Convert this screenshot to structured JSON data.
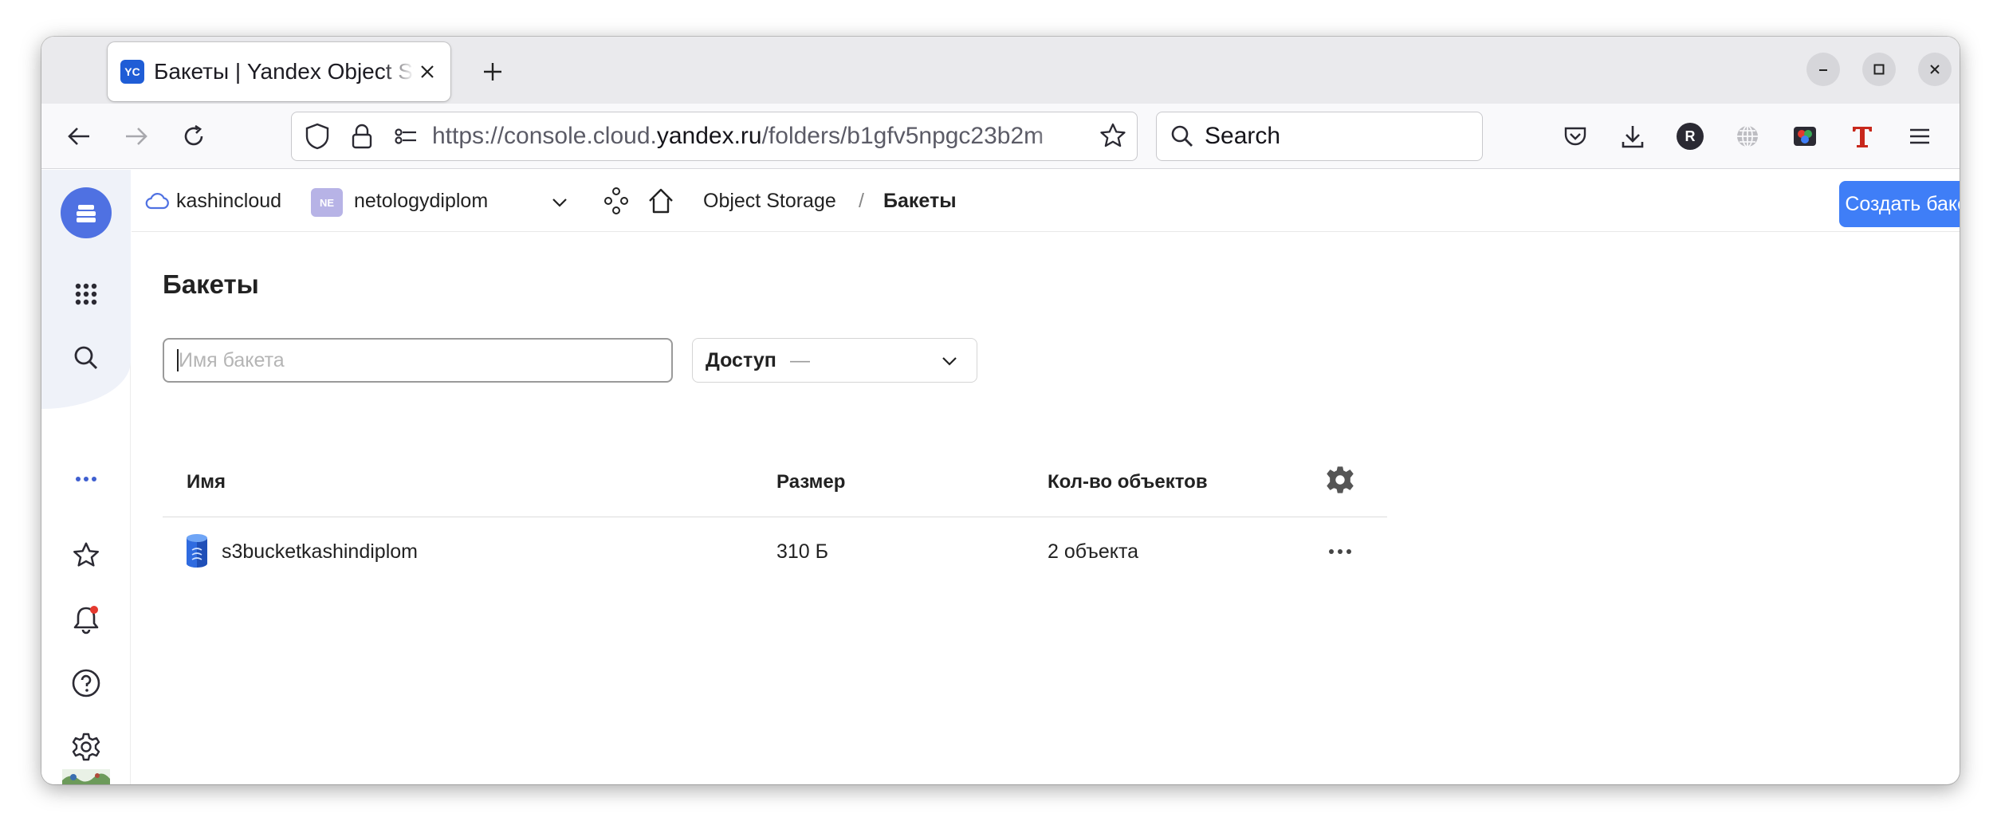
{
  "browser": {
    "tab": {
      "favicon_text": "YC",
      "title": "Бакеты | Yandex Object Storage"
    },
    "url": {
      "prefix": "https://console.cloud.",
      "domain": "yandex.ru",
      "path": "/folders/b1gfv5npgc23b2m"
    },
    "search": {
      "placeholder": "Search"
    },
    "toolbar": {
      "profile_initial": "R"
    }
  },
  "header": {
    "cloud": "kashincloud",
    "folder_badge": "NE",
    "folder": "netologydiplom",
    "service": "Object Storage",
    "separator": "/",
    "current": "Бакеты",
    "create_button": "Создать бакет"
  },
  "page": {
    "title": "Бакеты",
    "name_filter_placeholder": "Имя бакета",
    "access_label": "Доступ",
    "access_value": "—"
  },
  "table": {
    "columns": [
      "Имя",
      "Размер",
      "Кол-во объектов"
    ],
    "rows": [
      {
        "name": "s3bucketkashindiplom",
        "size": "310 Б",
        "objects": "2 объекта"
      }
    ]
  },
  "colors": {
    "accent": "#3f7ef7",
    "sidebar_logo": "#4f71e2",
    "notification_dot": "#e5392f"
  }
}
